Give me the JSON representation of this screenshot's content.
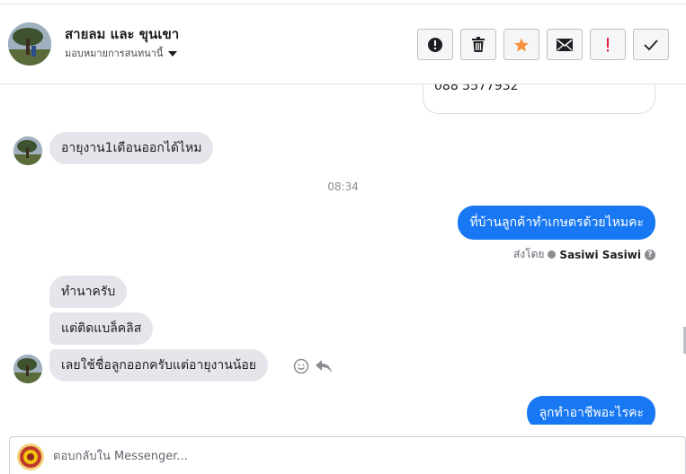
{
  "header": {
    "contact_name": "สายลม และ ขุนเขา",
    "assign_label": "มอบหมายการสนทนานี้",
    "toolbar": [
      {
        "name": "mark-spam-button",
        "icon": "alert-circle-icon"
      },
      {
        "name": "delete-button",
        "icon": "trash-icon"
      },
      {
        "name": "star-button",
        "icon": "star-icon"
      },
      {
        "name": "mark-unread-button",
        "icon": "envelope-icon"
      },
      {
        "name": "follow-up-button",
        "icon": "exclamation-icon"
      },
      {
        "name": "mark-done-button",
        "icon": "check-icon"
      }
    ]
  },
  "thread": {
    "contact_card_phone": "088 5577932",
    "messages": {
      "m1": "อายุงาน1เดือนออกได้ไหม",
      "timestamp": "08:34",
      "m2": "ที่บ้านลูกค้าทำเกษตรด้วยไหมคะ",
      "sent_by_label": "ส่งโดย",
      "sent_by_name": "Sasiwi Sasiwi",
      "m3": "ทำนาครับ",
      "m4": "แต่ติดแบล็คลิส",
      "m5": "เลยใช้ชื่อลูกออกครับแต่อายุงานน้อย",
      "m6": "ลูกทำอาชีพอะไรคะ"
    }
  },
  "composer": {
    "placeholder": "ตอบกลับใน Messenger..."
  },
  "colors": {
    "accent": "#1877f2",
    "incoming_bubble": "#e4e6eb",
    "star": "#f7923b",
    "follow_up": "#e41e3f"
  }
}
